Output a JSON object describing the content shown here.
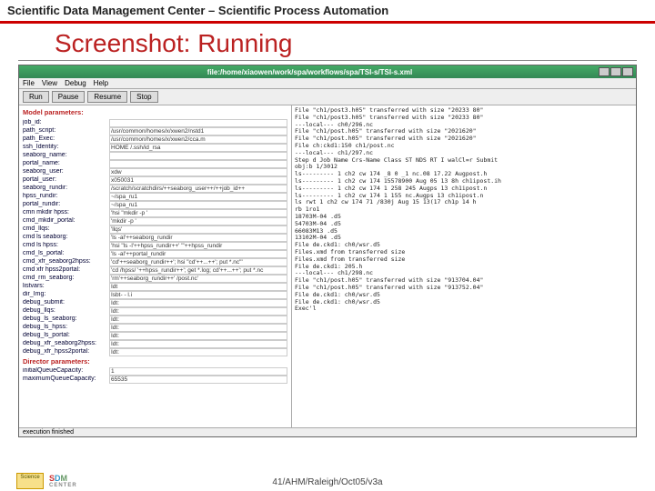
{
  "banner": "Scientific Data Management Center – Scientific Process Automation",
  "slide_title": "Screenshot: Running",
  "titlebar": "file:/home/xiaowen/work/spa/workflows/spa/TSI-s/TSI-s.xml",
  "menu": {
    "file": "File",
    "view": "View",
    "debug": "Debug",
    "help": "Help"
  },
  "toolbar": {
    "run": "Run",
    "pause": "Pause",
    "resume": "Resume",
    "stop": "Stop"
  },
  "sections": {
    "model": "Model parameters:",
    "director": "Director parameters:"
  },
  "params": [
    {
      "k": "job_id:",
      "v": ""
    },
    {
      "k": "path_script:",
      "v": "/usr/common/homes/x/xwen2/nstd1"
    },
    {
      "k": "path_Exec:",
      "v": "/usr/common/homes/x/xwen2/cca.m"
    },
    {
      "k": "ssh_Identity:",
      "v": "HOME    /.ssh/id_rsa"
    },
    {
      "k": "seaborg_name:",
      "v": ""
    },
    {
      "k": "portal_name:",
      "v": ""
    },
    {
      "k": "seaborg_user:",
      "v": "xdw"
    },
    {
      "k": "portal_user:",
      "v": "x050031"
    },
    {
      "k": "seaborg_rundir:",
      "v": "/scratch/scratchdirs/++seaborg_user++/++job_id++"
    },
    {
      "k": "hpss_rundir:",
      "v": "~/spa_ru1"
    },
    {
      "k": "portal_rundir:",
      "v": "~/spa_ru1"
    },
    {
      "k": "cmn mkdir hpss:",
      "v": "'hsi \"mkdir -p '"
    },
    {
      "k": "cmd_mkdir_portal:",
      "v": "'mkdir -p '"
    },
    {
      "k": "cmd_llqs:",
      "v": "'llqs'"
    },
    {
      "k": "cmd ls seaborg:",
      "v": "'ls -al'++seaborg_rundir"
    },
    {
      "k": "cmd ls hpss:",
      "v": "'hsi \"ls -l'++hpss_rundir++' \"'++hpss_rundir"
    },
    {
      "k": "cmd_ls_portal:",
      "v": "'ls -al'++portal_rundir"
    },
    {
      "k": "cmd_xfr_seaborg2hpss:",
      "v": "'cd'++seaborg_rundir++'; hsi \"cd'++...++'; put *.nc\"'"
    },
    {
      "k": "cmd xfr hpss2portal:",
      "v": "'cd /hpss/ '++hpss_rundir++'; get *.log; cd'++...++'; put *.nc"
    },
    {
      "k": "cmd_rm_seaborg:",
      "v": "'rm'++seaborg_rundir++' /post.nc'"
    },
    {
      "k": "listvars:",
      "v": "Idt"
    },
    {
      "k": "dir_Img:",
      "v": "Isbt- - l.i"
    },
    {
      "k": "debug_submit:",
      "v": "Idt:"
    },
    {
      "k": "debug_llqs:",
      "v": "Idt:"
    },
    {
      "k": "debug_ls_seaborg:",
      "v": "Idt:"
    },
    {
      "k": "debug_ls_hpss:",
      "v": "Idt:"
    },
    {
      "k": "debug_ls_portal:",
      "v": "Idt:"
    },
    {
      "k": "debug_xfr_seaborg2hpss:",
      "v": "Idt:"
    },
    {
      "k": "debug_xfr_hpss2portal:",
      "v": "Idt:"
    }
  ],
  "director": [
    {
      "k": "initialQueueCapacity:",
      "v": "1"
    },
    {
      "k": "maximumQueueCapacity:",
      "v": "65535"
    }
  ],
  "log": [
    "File \"ch1/post3.h05\" transferred with size \"20233 80\"",
    "File \"ch1/post3.h05\" transferred with size \"20233 80\"",
    "---local---  ch0/296.nc",
    "File \"ch1/post.h05\" transferred with size \"2021620\"",
    "File \"ch1/post.h05\" transferred with size \"2021620\"",
    "File ch:ckd1:150   ch1/post.nc",
    "---local---  ch1/297.nc",
    "Step  d      Job Name    Crs-Name   Class    ST NDS RT I  walCl=r  Submit",
    "",
    "obj:b 1/3012",
    "ls---------  1 ch2        cw  174      _8 0 _1 nc.08  17.22 Augpost.h",
    "ls---------  1 ch2        cw  174  15578900 Aug 05 13 8h  ch1ipost.ih",
    "ls---------  1 ch2        cw  174    1 258 245 Augps 13 ch1ipost.n",
    "ls---------  1 ch2        cw  174    1 155 nc.Augps 13 ch1ipost.n",
    "ls rwt       1 ch2        cw  174    71 /830j Aug 15 13(17  ch1p 14 h",
    "",
    "rb 1ro1",
    "18703M-04 .d5",
    "54703M-04 .d5",
    "66083M13 .d5",
    "13102M-04 .d5",
    "File de.ckd1: ch0/wsr.d5",
    "Files.xmd from transferred size",
    "Files.xmd from transferred size",
    "File de.ckd1: 205.h",
    "---local---  ch1/298.nc",
    "File \"ch1/post.h05\" transferred with size \"913704.04\"",
    "File \"ch1/post.h05\" transferred with size \"913752.04\"",
    "File de.ckd1: ch0/wsr.d5",
    "File de.ckd1: ch0/wsr.d5",
    "Exec'l"
  ],
  "status": "execution finished",
  "footer": "41/AHM/Raleigh/Oct05/v3a",
  "logos": {
    "science": "Science",
    "sdm": {
      "s": "S",
      "d": "D",
      "m": "M",
      "center": "CENTER"
    }
  }
}
